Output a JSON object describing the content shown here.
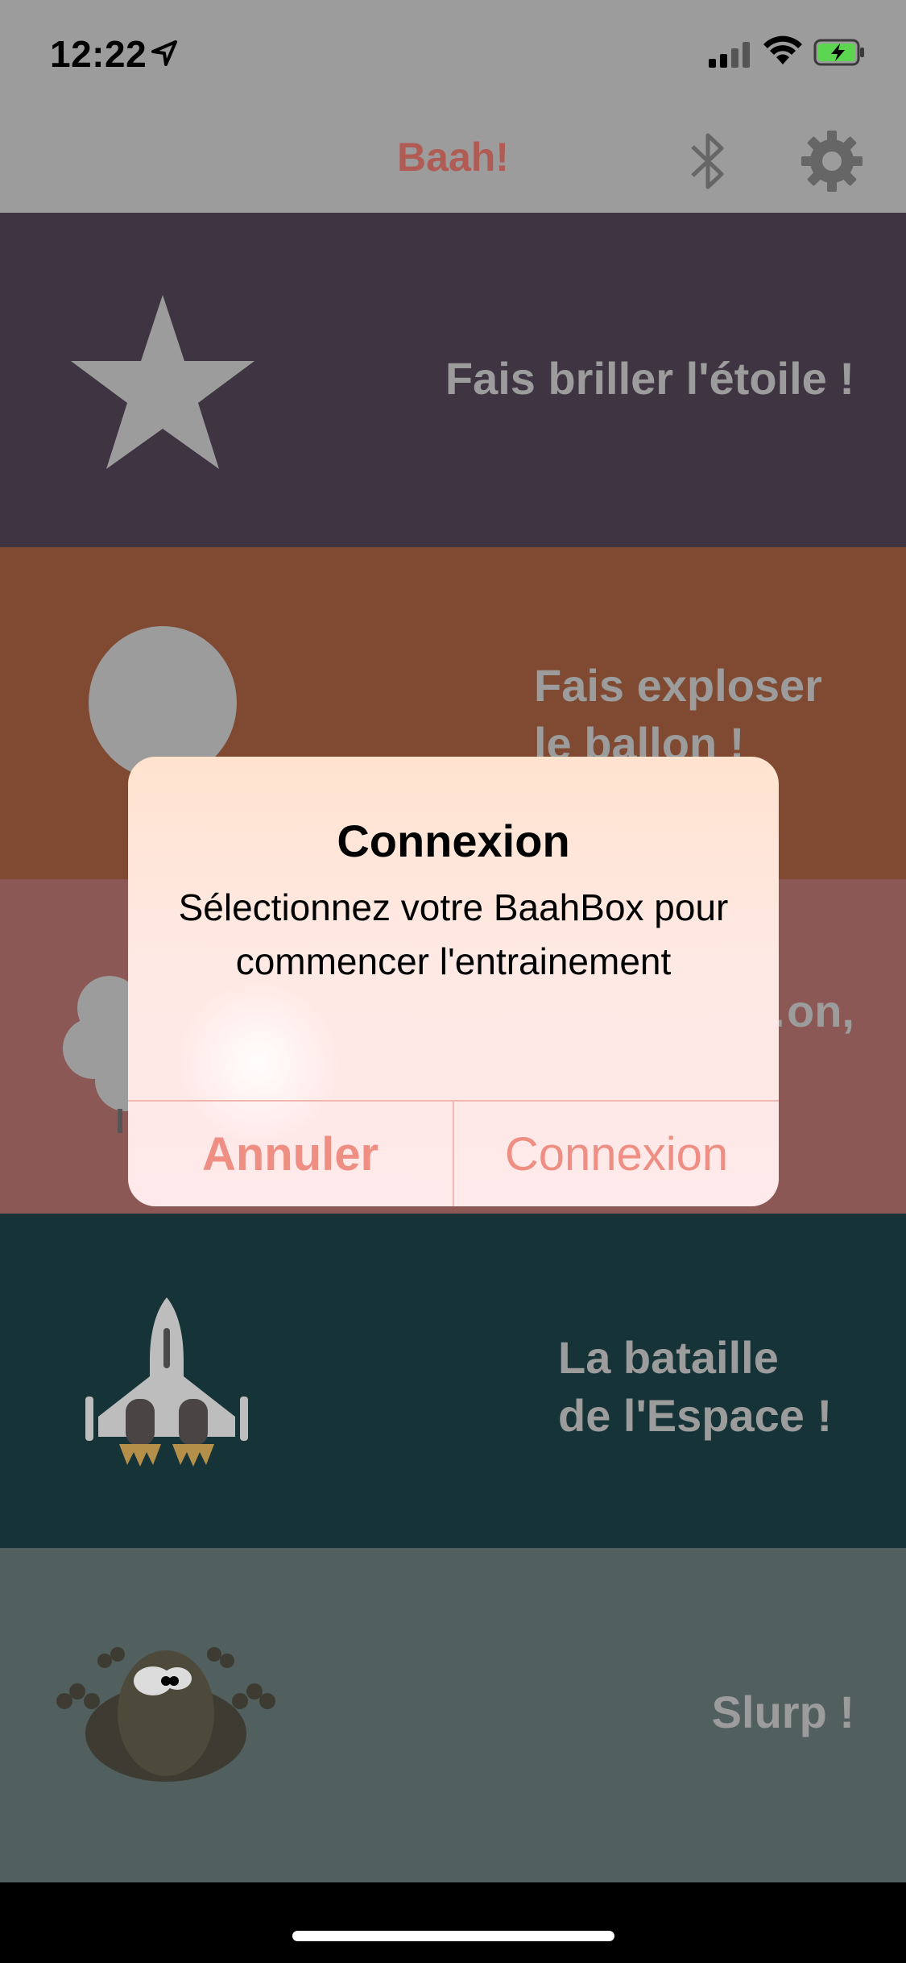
{
  "status_bar": {
    "time": "12:22"
  },
  "nav": {
    "title": "Baah!"
  },
  "rows": [
    {
      "label": "Fais briller l'étoile !"
    },
    {
      "label": "Fais exploser\nle ballon !"
    },
    {
      "label": "…on,"
    },
    {
      "label": "La bataille\nde l'Espace !"
    },
    {
      "label": "Slurp !"
    }
  ],
  "alert": {
    "title": "Connexion",
    "message": "Sélectionnez votre BaahBox pour commencer l'entrainement",
    "cancel_label": "Annuler",
    "connect_label": "Connexion"
  },
  "colors": {
    "nav_bg": "#9c9c9c",
    "title": "#b05c55",
    "row1": "#3f3442",
    "row2": "#7f4a31",
    "row3": "#8c5855",
    "row4": "#163337",
    "row5": "#515f5f",
    "alert_button": "#ef8f84"
  }
}
